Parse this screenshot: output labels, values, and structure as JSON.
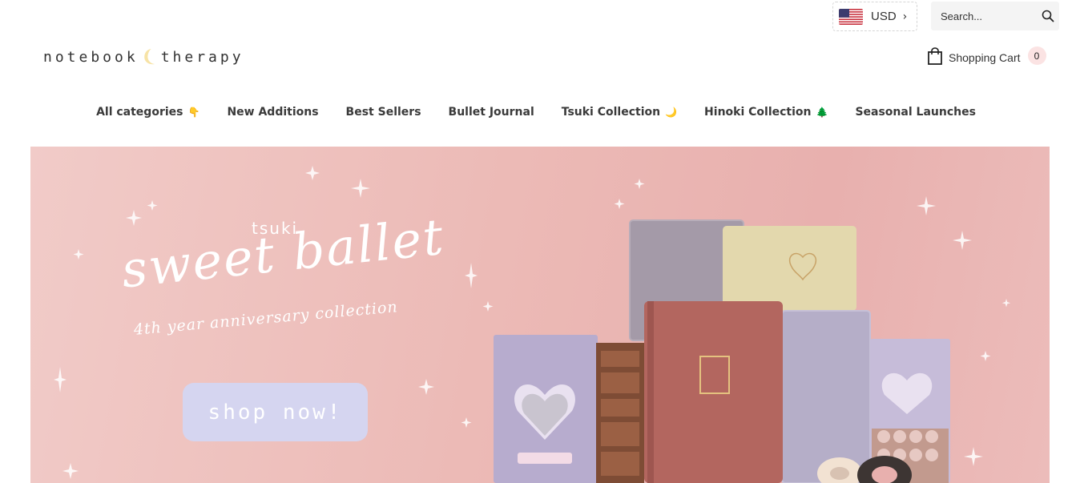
{
  "topbar": {
    "currency": {
      "code": "USD",
      "flag_icon": "us-flag-icon",
      "chevron": "›"
    },
    "search": {
      "placeholder": "Search...",
      "icon": "search-icon"
    }
  },
  "logo": {
    "left": "notebook",
    "right": "therapy",
    "icon": "crescent-moon-icon"
  },
  "cart": {
    "label": "Shopping Cart",
    "count": "0",
    "icon": "shopping-bag-icon"
  },
  "nav": {
    "items": [
      {
        "label": "All categories",
        "emoji": "👇"
      },
      {
        "label": "New Additions",
        "emoji": ""
      },
      {
        "label": "Best Sellers",
        "emoji": ""
      },
      {
        "label": "Bullet Journal",
        "emoji": ""
      },
      {
        "label": "Tsuki Collection",
        "emoji": "🌙"
      },
      {
        "label": "Hinoki Collection",
        "emoji": "🌲"
      },
      {
        "label": "Seasonal Launches",
        "emoji": ""
      }
    ]
  },
  "hero": {
    "brand": "tsuki",
    "title": "sweet ballet",
    "subtitle": "4th year anniversary collection",
    "cta": "shop now!",
    "colors": {
      "background": "#ecbab6",
      "button": "#d5d5f0"
    }
  }
}
